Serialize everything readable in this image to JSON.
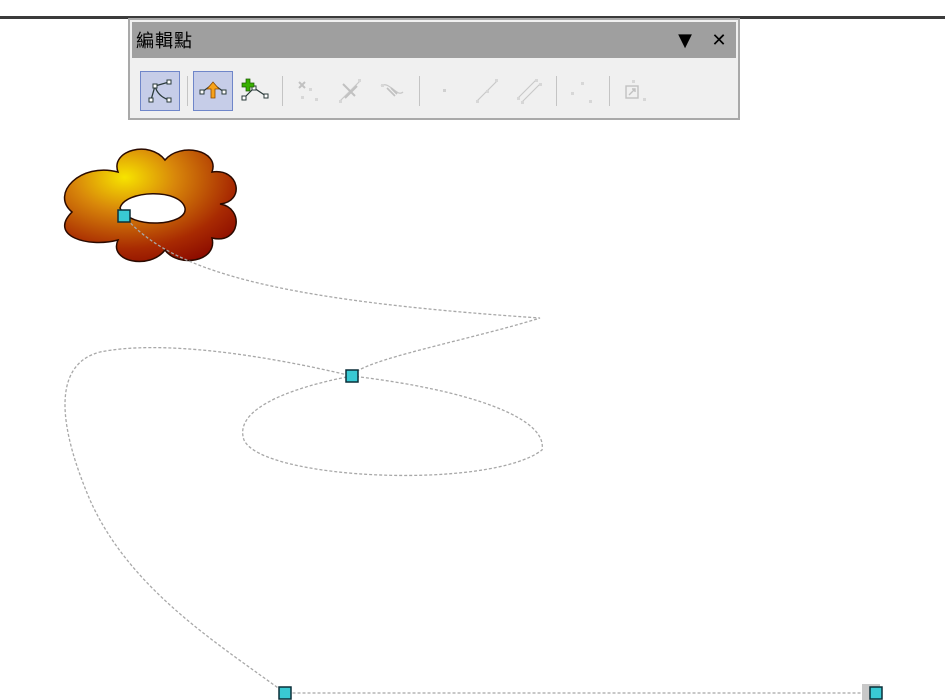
{
  "toolbar": {
    "title": "編輯點",
    "menu_glyph": "▼",
    "close_glyph": "✕",
    "buttons": [
      {
        "name": "points-mode-button",
        "icon": "edit-points-icon",
        "active": true,
        "enabled": true
      },
      {
        "name": "move-points-button",
        "icon": "move-points-icon",
        "active": true,
        "enabled": true
      },
      {
        "name": "insert-points-button",
        "icon": "insert-points-icon",
        "active": false,
        "enabled": true
      },
      {
        "name": "delete-points-button",
        "icon": "delete-points-icon",
        "active": false,
        "enabled": false
      },
      {
        "name": "split-curve-button",
        "icon": "split-curve-icon",
        "active": false,
        "enabled": false
      },
      {
        "name": "convert-to-curve-button",
        "icon": "convert-curve-icon",
        "active": false,
        "enabled": false
      },
      {
        "name": "corner-point-button",
        "icon": "corner-point-icon",
        "active": false,
        "enabled": false
      },
      {
        "name": "smooth-transition-button",
        "icon": "smooth-transition-icon",
        "active": false,
        "enabled": false
      },
      {
        "name": "symmetric-transition-button",
        "icon": "symmetric-transition-icon",
        "active": false,
        "enabled": false
      },
      {
        "name": "close-bezier-button",
        "icon": "close-bezier-icon",
        "active": false,
        "enabled": false
      },
      {
        "name": "eliminate-points-button",
        "icon": "eliminate-points-icon",
        "active": false,
        "enabled": false
      }
    ]
  },
  "colors": {
    "handle_fill": "#39c9d3",
    "handle_stroke": "#0b2f38",
    "path_stroke": "#a8a8a8",
    "flower_light": "#f7e400",
    "flower_mid": "#c8650a",
    "flower_dark": "#8b0a00",
    "active_button_bg": "#c6cde8",
    "titlebar_bg": "#9f9f9f"
  },
  "canvas": {
    "shape": "flower-shape",
    "path": "motion-path-curve"
  }
}
